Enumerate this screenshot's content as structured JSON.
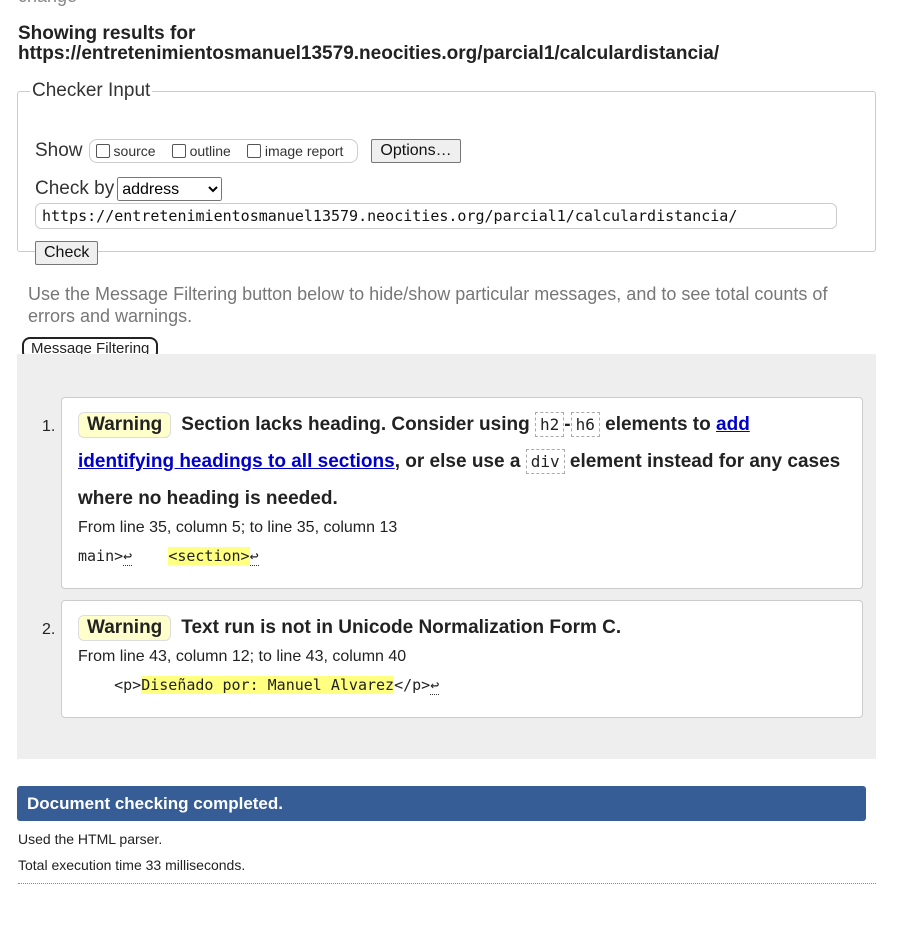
{
  "cutoff_text": "change",
  "heading_line1": "Showing results for",
  "heading_url": "https://entretenimientosmanuel13579.neocities.org/parcial1/calculardistancia/",
  "checker": {
    "legend": "Checker Input",
    "show_label": "Show",
    "options": [
      "source",
      "outline",
      "image report"
    ],
    "options_button": "Options…",
    "check_by_label": "Check by",
    "check_by_value": "address",
    "url_value": "https://entretenimientosmanuel13579.neocities.org/parcial1/calculardistancia/",
    "check_button": "Check"
  },
  "intro": "Use the Message Filtering button below to hide/show particular messages, and to see total counts of errors and warnings.",
  "filter_button": "Message Filtering",
  "messages": [
    {
      "num": "1.",
      "type": "Warning",
      "t1": "Section lacks heading. Consider using ",
      "c1": "h2",
      "dash": "-",
      "c2": "h6",
      "t2": " elements to ",
      "link": "add identifying headings to all sections",
      "t3": ", or else use a ",
      "c3": "div",
      "t4": " element instead for any cases where no heading is needed.",
      "location": "From line 35, column 5; to line 35, column 13",
      "src_pre": "main>",
      "src_gap": "    ",
      "src_hl": "<section>"
    },
    {
      "num": "2.",
      "type": "Warning",
      "text": "Text run is not in Unicode Normalization Form C.",
      "location": "From line 43, column 12; to line 43, column 40",
      "src_pre": "    <p>",
      "src_hl": "Diseñado por: Manuel Alvarez",
      "src_post": "</p>"
    }
  ],
  "status": "Document checking completed.",
  "parser": "Used the HTML parser.",
  "exec_time": "Total execution time 33 milliseconds.",
  "colors": {
    "status_bar": "#365d95",
    "warning_bg": "#ffffcc",
    "highlight": "#ffff80",
    "link": "#0000cc"
  }
}
